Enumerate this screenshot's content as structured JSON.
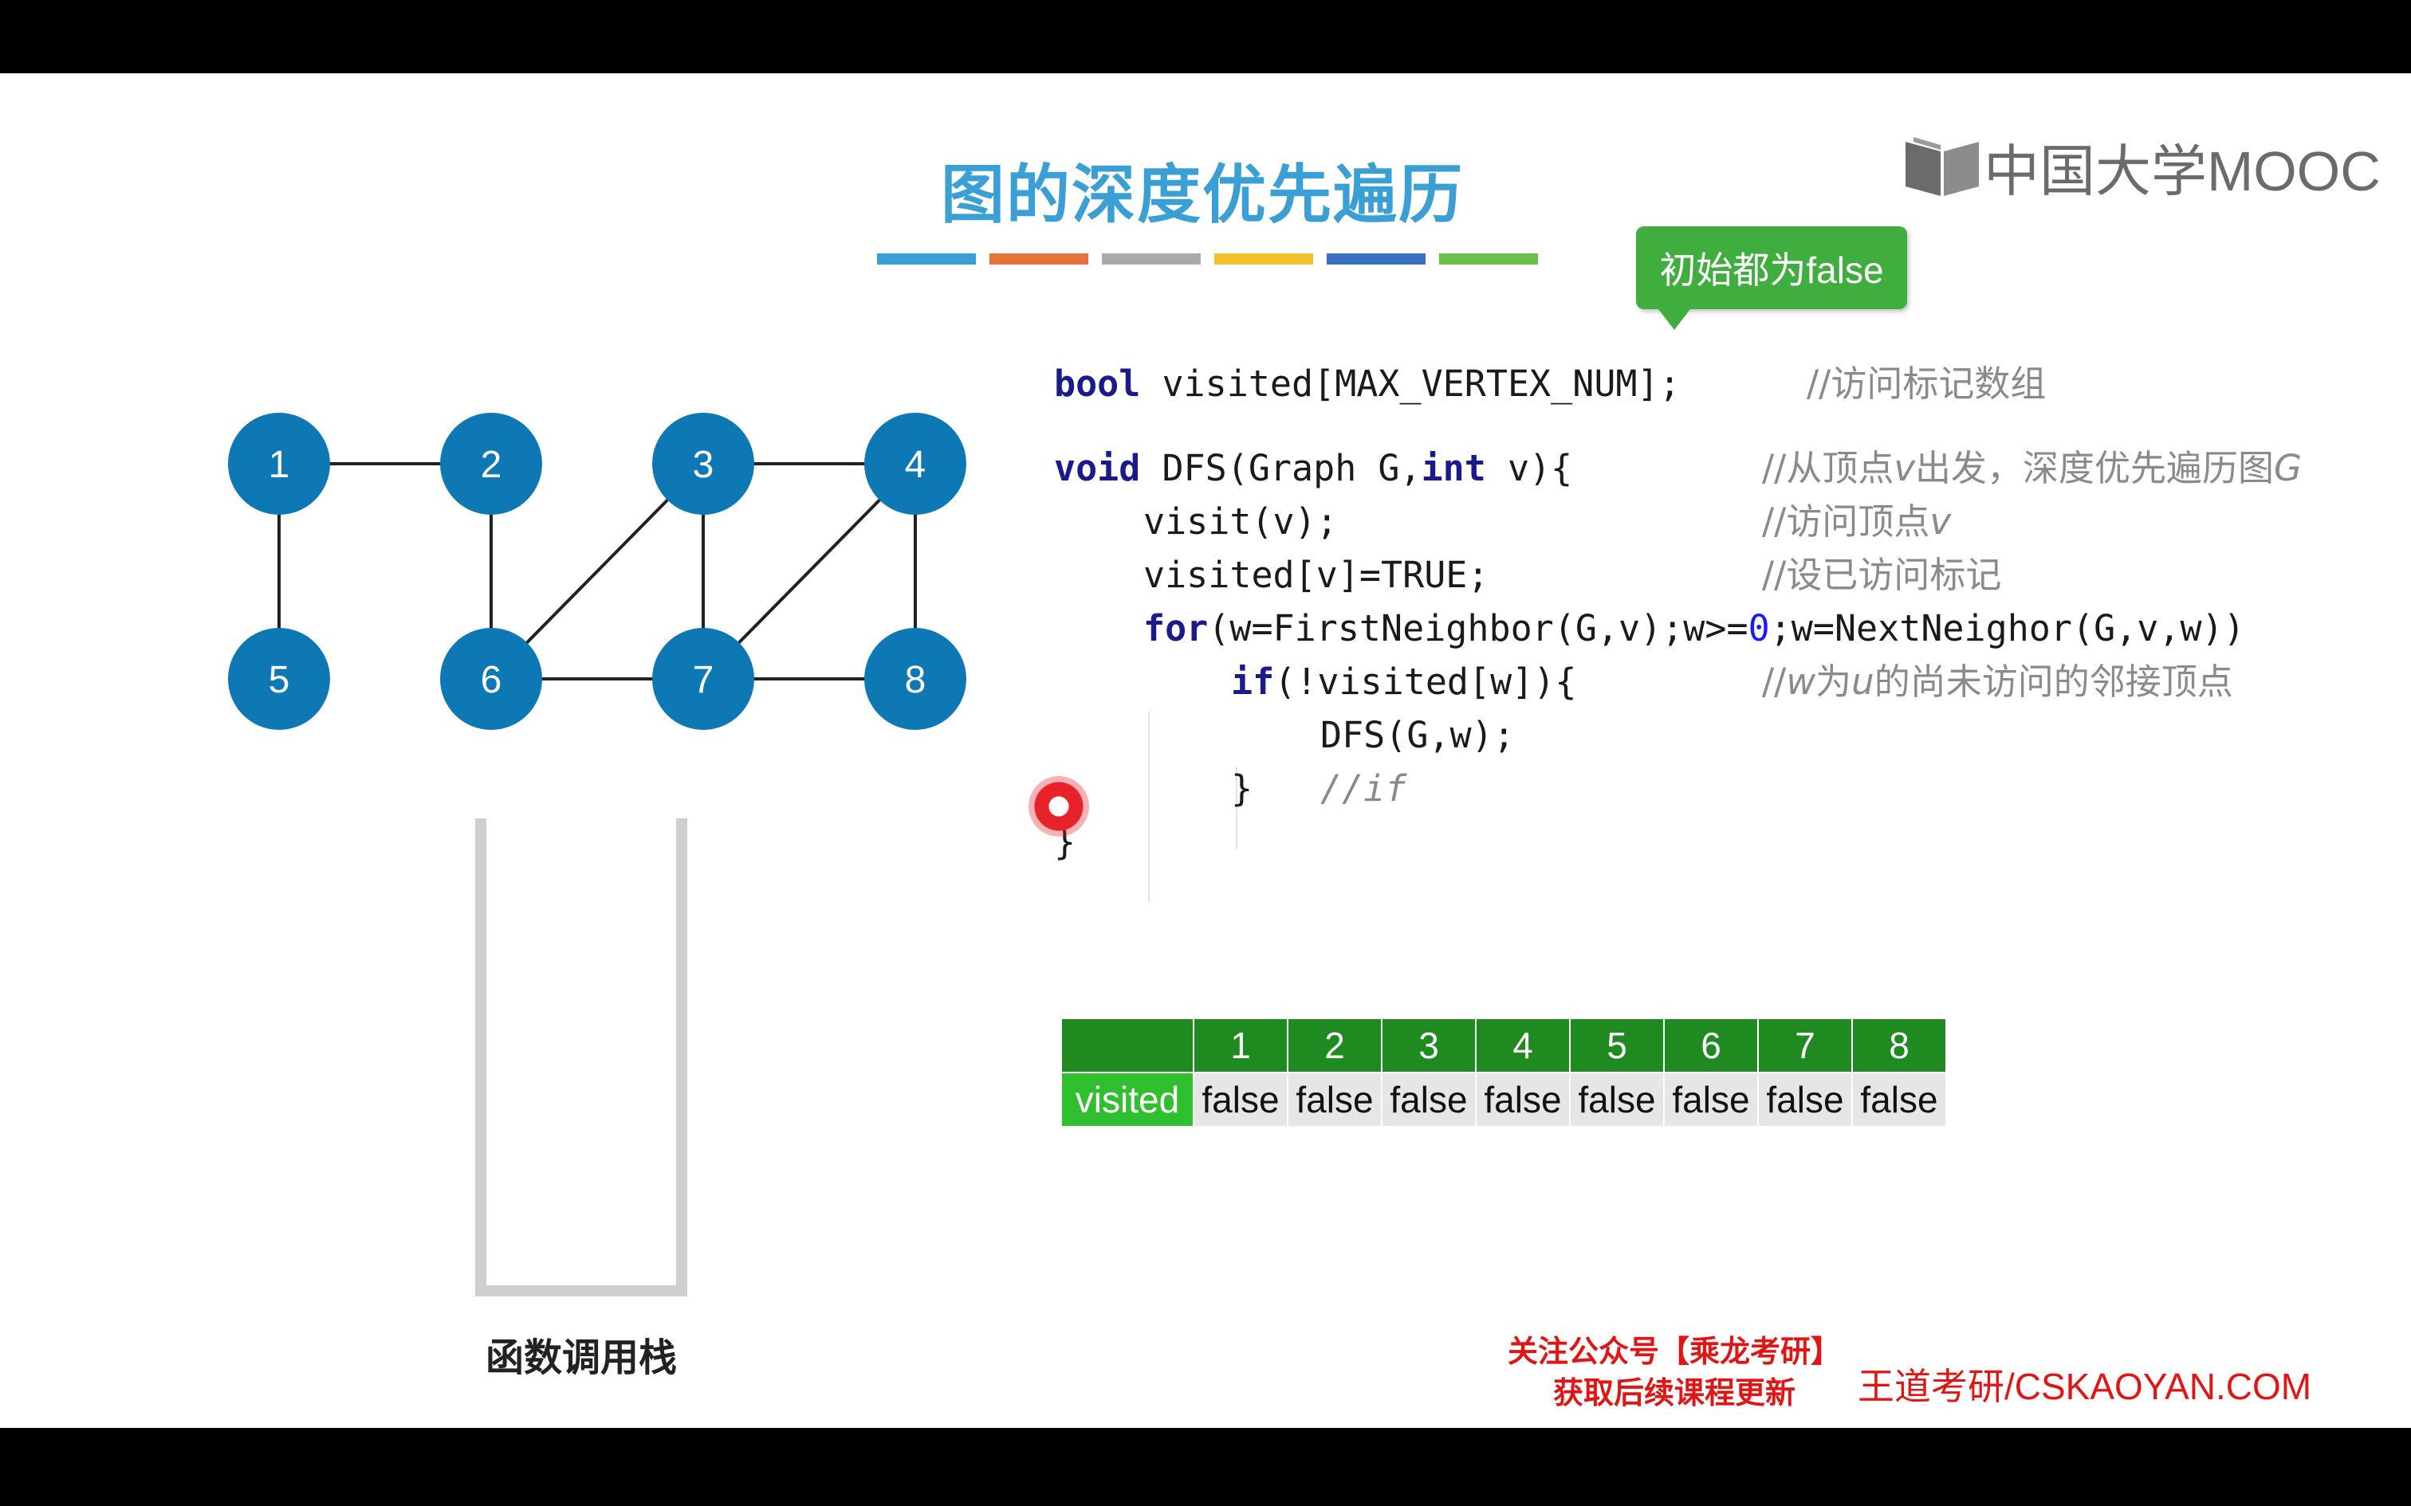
{
  "slide": {
    "title": "图的深度优先遍历",
    "accent_bars": [
      "#3a9fd4",
      "#e8733a",
      "#a9a9a9",
      "#f2c12e",
      "#3a6fc4",
      "#6cc04a"
    ]
  },
  "logo": {
    "text": "中国大学MOOC"
  },
  "tooltip": {
    "text": "初始都为false"
  },
  "graph": {
    "node_color": "#0e78b4",
    "nodes": [
      "1",
      "2",
      "3",
      "4",
      "5",
      "6",
      "7",
      "8"
    ],
    "edges": [
      [
        "1",
        "2"
      ],
      [
        "1",
        "5"
      ],
      [
        "2",
        "6"
      ],
      [
        "3",
        "6"
      ],
      [
        "3",
        "7"
      ],
      [
        "3",
        "4"
      ],
      [
        "4",
        "7"
      ],
      [
        "4",
        "8"
      ],
      [
        "6",
        "7"
      ],
      [
        "7",
        "8"
      ]
    ]
  },
  "stack": {
    "label": "函数调用栈"
  },
  "code": {
    "line1_kw": "bool",
    "line1_text": " visited[MAX_VERTEX_NUM];",
    "line1_comment": "//访问标记数组",
    "line2_kw_void": "void",
    "line2_a": " DFS(Graph G,",
    "line2_kw_int": "int",
    "line2_b": " v){",
    "line2_comment_a": "//从顶点",
    "line2_comment_v": "v",
    "line2_comment_b": "出发，深度优先遍历图",
    "line2_comment_g": "G",
    "line3_text": "visit(v);",
    "line3_comment_a": "//访问顶点",
    "line3_comment_v": "v",
    "line4_text": "visited[v]=TRUE;",
    "line4_comment": "//设已访问标记",
    "line5_kw": "for",
    "line5_a": "(w=FirstNeighbor(G,v);w>=",
    "line5_num": "0",
    "line5_b": ";w=NextNeighor(G,v,w))",
    "line6_kw": "if",
    "line6_text": "(!visited[w]){",
    "line6_comment_a": "//",
    "line6_comment_w": "w",
    "line6_comment_b": "为",
    "line6_comment_u": "u",
    "line6_comment_c": "的尚未访问的邻接顶点",
    "line7_text": "DFS(G,w);",
    "line8_text": "}",
    "line8_comment": "//if",
    "line9_text": "}"
  },
  "visited_table": {
    "row_label": "visited",
    "columns": [
      "1",
      "2",
      "3",
      "4",
      "5",
      "6",
      "7",
      "8"
    ],
    "values": [
      "false",
      "false",
      "false",
      "false",
      "false",
      "false",
      "false",
      "false"
    ]
  },
  "footer": {
    "promo_line1": "关注公众号【乘龙考研】",
    "promo_line2": "获取后续课程更新",
    "site": "王道考研/CSKAOYAN.COM"
  }
}
